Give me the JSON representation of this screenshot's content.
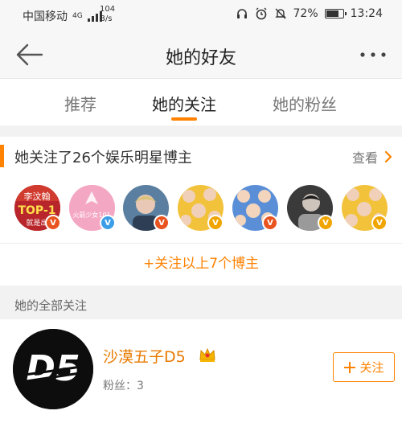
{
  "status_bar": {
    "carrier": "中国移动",
    "network": "4G",
    "speed_value": "104",
    "speed_unit": "B/s",
    "battery_percent": "72%",
    "battery_level": 0.72,
    "time": "13:24"
  },
  "header": {
    "title": "她的好友",
    "back_icon": "back-arrow-icon",
    "more_icon": "more-dots-icon"
  },
  "tabs": [
    {
      "label": "推荐",
      "active": false
    },
    {
      "label": "她的关注",
      "active": true
    },
    {
      "label": "她的粉丝",
      "active": false
    }
  ],
  "accent_color": "#ff8200",
  "following_section": {
    "title": "她关注了26个娱乐明星博主",
    "view_label": "查看",
    "avatars": [
      {
        "badge": "V",
        "badge_color": "#e8531f",
        "text": "李汶翰 TOP-1 就是出"
      },
      {
        "badge": "V",
        "badge_color": "#3d9ee8",
        "text": "火箭少女101"
      },
      {
        "badge": "V",
        "badge_color": "#e8531f",
        "text": ""
      },
      {
        "badge": "V",
        "badge_color": "#f0a500",
        "text": ""
      },
      {
        "badge": "V",
        "badge_color": "#e8531f",
        "text": ""
      },
      {
        "badge": "V",
        "badge_color": "#f0a500",
        "text": ""
      },
      {
        "badge": "V",
        "badge_color": "#f0a500",
        "text": ""
      }
    ],
    "follow_more_label": "+关注以上7个博主"
  },
  "all_following": {
    "label": "她的全部关注",
    "users": [
      {
        "name": "沙漠五子D5",
        "fans": "粉丝：3",
        "avatar_text": "D5",
        "follow_label": "关注"
      }
    ]
  }
}
